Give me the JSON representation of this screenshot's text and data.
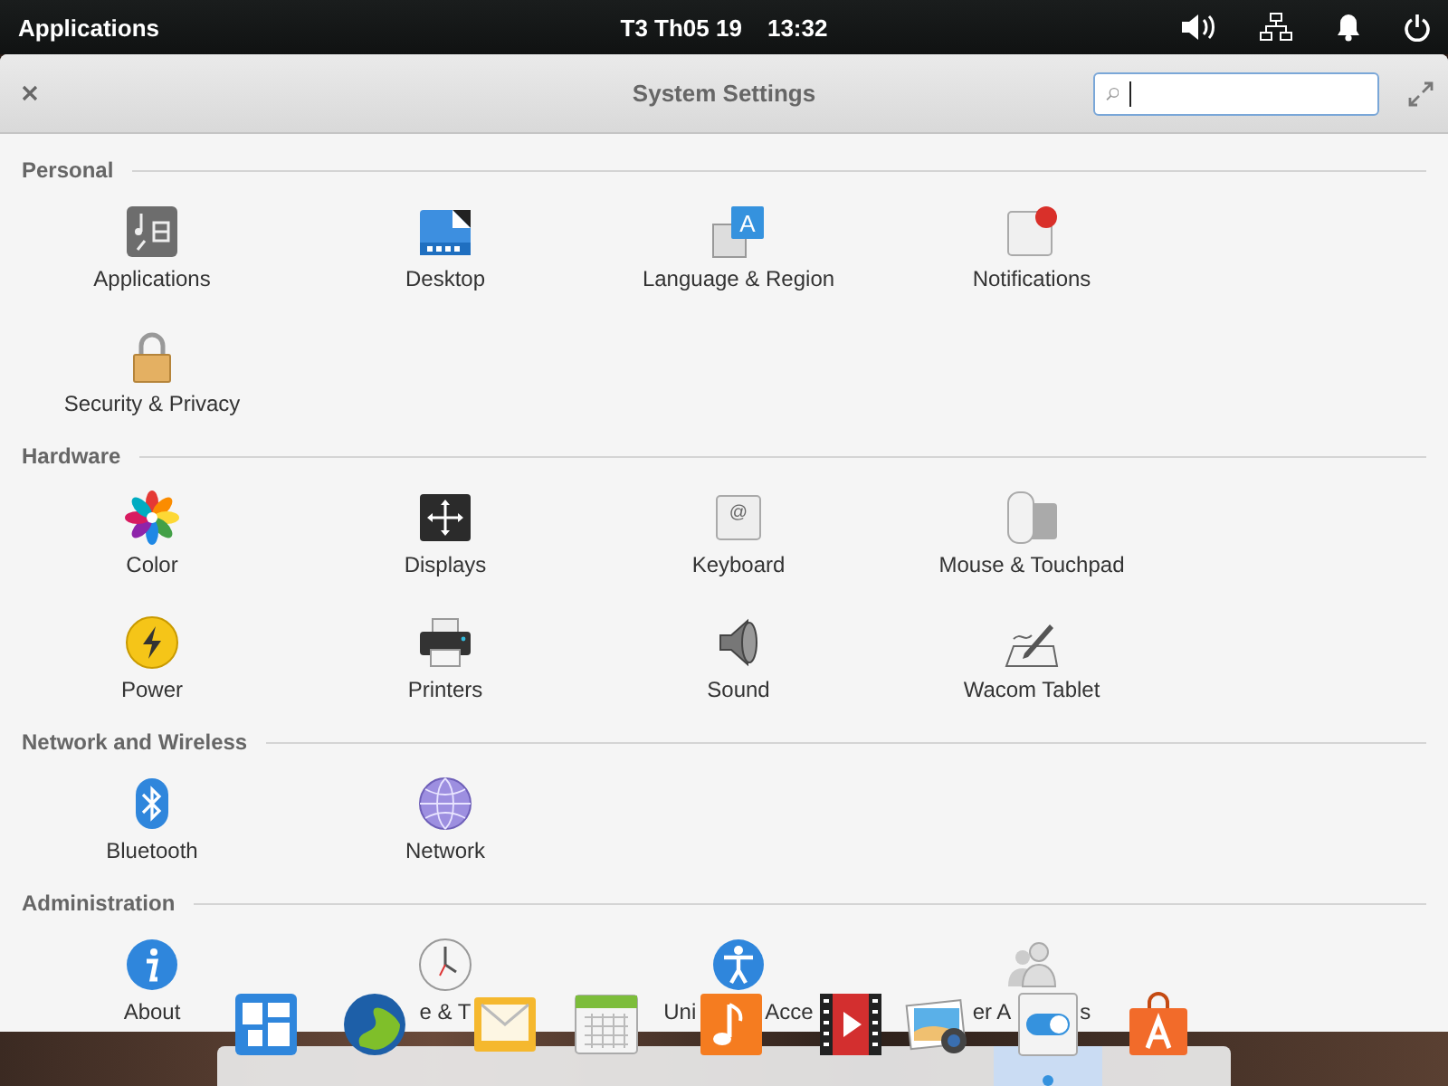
{
  "top_panel": {
    "applications_label": "Applications",
    "date": "T3 Th05 19",
    "time": "13:32"
  },
  "window": {
    "title": "System Settings"
  },
  "sections": [
    {
      "title": "Personal",
      "items": [
        {
          "label": "Applications",
          "kind": "applications"
        },
        {
          "label": "Desktop",
          "kind": "desktop"
        },
        {
          "label": "Language & Region",
          "kind": "language",
          "icon_glyph": "A"
        },
        {
          "label": "Notifications",
          "kind": "notifications"
        },
        {
          "label": "Security & Privacy",
          "kind": "security"
        }
      ]
    },
    {
      "title": "Hardware",
      "items": [
        {
          "label": "Color",
          "kind": "color"
        },
        {
          "label": "Displays",
          "kind": "displays"
        },
        {
          "label": "Keyboard",
          "kind": "keyboard",
          "icon_glyph": "@"
        },
        {
          "label": "Mouse & Touchpad",
          "kind": "mouse"
        },
        {
          "label": "Power",
          "kind": "power"
        },
        {
          "label": "Printers",
          "kind": "printers"
        },
        {
          "label": "Sound",
          "kind": "sound"
        },
        {
          "label": "Wacom Tablet",
          "kind": "wacom"
        }
      ]
    },
    {
      "title": "Network and Wireless",
      "items": [
        {
          "label": "Bluetooth",
          "kind": "bluetooth"
        },
        {
          "label": "Network",
          "kind": "network"
        }
      ]
    },
    {
      "title": "Administration",
      "items": [
        {
          "label_fragments": [
            "About"
          ],
          "kind": "about"
        },
        {
          "label_fragments": [
            "e & T"
          ],
          "kind": "datetime"
        },
        {
          "label_fragments": [
            "Uni",
            "Acce"
          ],
          "kind": "accessibility"
        },
        {
          "label_fragments": [
            "er A",
            "s"
          ],
          "kind": "users"
        }
      ]
    }
  ],
  "dock": {
    "items": [
      {
        "kind": "multitasking",
        "running": false
      },
      {
        "kind": "browser",
        "running": false
      },
      {
        "kind": "mail",
        "running": false
      },
      {
        "kind": "calendar",
        "running": false
      },
      {
        "kind": "music",
        "running": false
      },
      {
        "kind": "videos",
        "running": false
      },
      {
        "kind": "photos",
        "running": false
      },
      {
        "kind": "switchboard",
        "running": true
      },
      {
        "kind": "appcenter",
        "running": false
      }
    ]
  }
}
